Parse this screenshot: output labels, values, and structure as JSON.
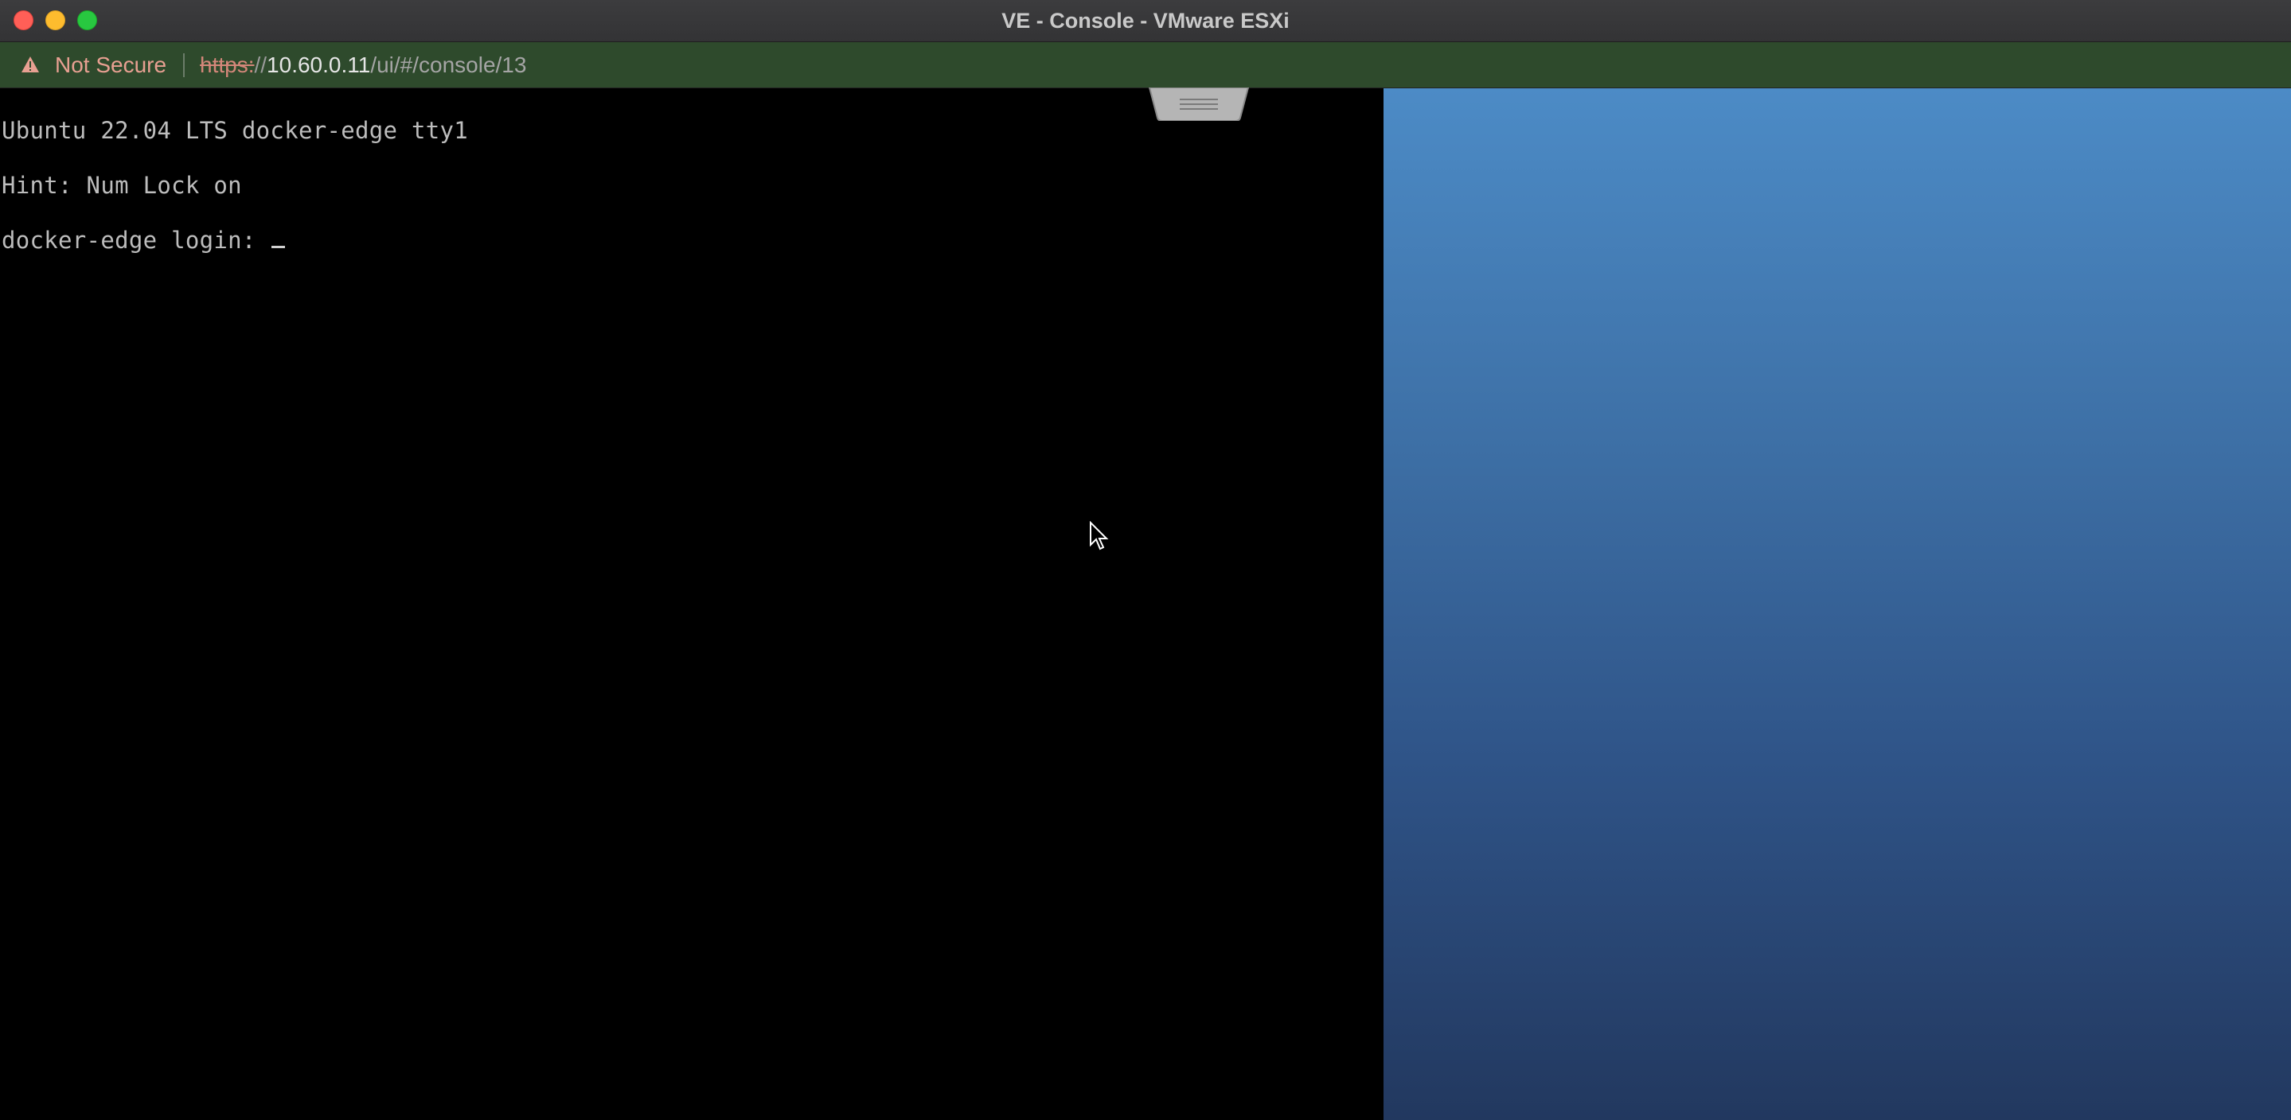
{
  "window": {
    "title": "VE - Console - VMware ESXi"
  },
  "address_bar": {
    "security_label": "Not Secure",
    "url_scheme": "https:",
    "url_separator": "//",
    "url_host": "10.60.0.11",
    "url_path": "/ui/#/console/13"
  },
  "console": {
    "lines": [
      "Ubuntu 22.04 LTS docker-edge tty1",
      "Hint: Num Lock on",
      "docker-edge login: "
    ]
  },
  "icons": {
    "warning": "warning-triangle-icon",
    "handle": "drag-handle-icon",
    "pointer": "mouse-pointer-icon"
  },
  "colors": {
    "title_bar": "#3c3c3e",
    "address_bar": "#2e4a2c",
    "console_bg": "#000000",
    "console_text": "#bdbdbd",
    "desktop_top": "#4c8bc6",
    "desktop_bottom": "#22385f"
  }
}
